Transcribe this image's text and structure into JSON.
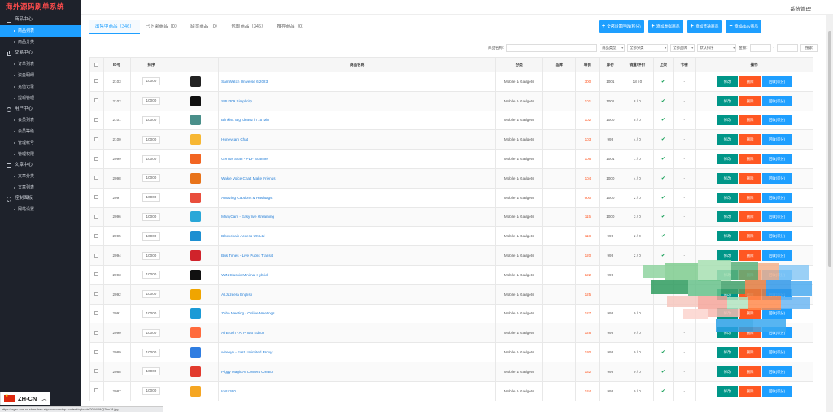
{
  "brand": "海外源码刷单系统",
  "header": {
    "sys_admin": "系统管理"
  },
  "sidebar": {
    "groups": [
      {
        "label": "商品中心",
        "icon": "house-icon",
        "items": [
          {
            "label": "商品列表",
            "active": true
          },
          {
            "label": "商品分类",
            "active": false
          }
        ]
      },
      {
        "label": "交易中心",
        "icon": "chart-icon",
        "items": [
          {
            "label": "订单列表",
            "active": false
          },
          {
            "label": "资金明细",
            "active": false
          },
          {
            "label": "充值记录",
            "active": false
          },
          {
            "label": "提现管理",
            "active": false
          }
        ]
      },
      {
        "label": "用户中心",
        "icon": "user-icon",
        "items": [
          {
            "label": "会员列表",
            "active": false
          },
          {
            "label": "会员等级",
            "active": false
          },
          {
            "label": "管理帐号",
            "active": false
          },
          {
            "label": "管理权限",
            "active": false
          }
        ]
      },
      {
        "label": "文章中心",
        "icon": "document-icon",
        "items": [
          {
            "label": "文章分类",
            "active": false
          },
          {
            "label": "文章列表",
            "active": false
          }
        ]
      },
      {
        "label": "控制面板",
        "icon": "gear-icon",
        "items": [
          {
            "label": "网站设置",
            "active": false
          }
        ]
      }
    ]
  },
  "language": {
    "code": "ZH-CN"
  },
  "status_url": "https://tsgzc-ecs-cn-shenzhen.aliyuncs.com/wp-content/uploads/2024/09/Q2ips18.jpg",
  "tabs": [
    {
      "label": "出售中商品（346）",
      "active": true
    },
    {
      "label": "已下架商品（0）",
      "active": false
    },
    {
      "label": "缺货商品（0）",
      "active": false
    },
    {
      "label": "包邮商品（346）",
      "active": false
    },
    {
      "label": "推荐商品（0）",
      "active": false
    }
  ],
  "actions": [
    "全部设置回收(积分)",
    "添加虚拟商品",
    "添加普通商品",
    "添加ebay商品"
  ],
  "filters": {
    "name_label": "商品名称:",
    "type_select": "商品类型",
    "category_select": "全部分类",
    "brand_select": "全部品牌",
    "sort_select": "默认排序",
    "price_label": "金额:",
    "range_sep": "-",
    "search_button": "搜索"
  },
  "table": {
    "columns": [
      "",
      "ID号",
      "排序",
      "",
      "商品名称",
      "分类",
      "品牌",
      "单价",
      "库存",
      "销量/评价",
      "上架",
      "卡密",
      "操作"
    ],
    "op_labels": {
      "edit": "修改",
      "delete": "删除",
      "recycle": "回收(积分)"
    },
    "rows": [
      {
        "id": "2103",
        "sort": "10000",
        "name": "SamWatch Universe 6 2023",
        "category": "Mobile & Gadgets",
        "price": "300",
        "stock": "1001",
        "sales": "18 / 0",
        "listed": "✔",
        "card": "-",
        "thumb": "#222222"
      },
      {
        "id": "2102",
        "sort": "10000",
        "name": "SPU309 Simplicity",
        "category": "Mobile & Gadgets",
        "price": "101",
        "stock": "1001",
        "sales": "8 / 0",
        "listed": "✔",
        "card": "-",
        "thumb": "#111111"
      },
      {
        "id": "2101",
        "sort": "10000",
        "name": "Blinkist: Big Ideas2 in 15 Min",
        "category": "Mobile & Gadgets",
        "price": "102",
        "stock": "1000",
        "sales": "5 / 0",
        "listed": "✔",
        "card": "-",
        "thumb": "#4a8f8a"
      },
      {
        "id": "2100",
        "sort": "10000",
        "name": "Honeycam Chat",
        "category": "Mobile & Gadgets",
        "price": "103",
        "stock": "999",
        "sales": "4 / 0",
        "listed": "✔",
        "card": "-",
        "thumb": "#f7b733"
      },
      {
        "id": "2099",
        "sort": "10000",
        "name": "Genius Scan - PDF Scanner",
        "category": "Mobile & Gadgets",
        "price": "106",
        "stock": "1001",
        "sales": "1 / 0",
        "listed": "✔",
        "card": "-",
        "thumb": "#f26522"
      },
      {
        "id": "2098",
        "sort": "10000",
        "name": "Wakie Voice Chat: Make Friends",
        "category": "Mobile & Gadgets",
        "price": "104",
        "stock": "1000",
        "sales": "4 / 0",
        "listed": "✔",
        "card": "-",
        "thumb": "#e8731a"
      },
      {
        "id": "2097",
        "sort": "10000",
        "name": "Amazing Captions & Hashtags",
        "category": "Mobile & Gadgets",
        "price": "900",
        "stock": "1000",
        "sales": "2 / 0",
        "listed": "✔",
        "card": "-",
        "thumb": "#e94e3c"
      },
      {
        "id": "2096",
        "sort": "10000",
        "name": "ManyCam - Easy live streaming",
        "category": "Mobile & Gadgets",
        "price": "115",
        "stock": "1000",
        "sales": "3 / 0",
        "listed": "✔",
        "card": "-",
        "thumb": "#2aa7d8"
      },
      {
        "id": "2095",
        "sort": "10000",
        "name": "Blockchain Access UK Ltd",
        "category": "Mobile & Gadgets",
        "price": "118",
        "stock": "999",
        "sales": "2 / 0",
        "listed": "✔",
        "card": "-",
        "thumb": "#1d8fd1"
      },
      {
        "id": "2094",
        "sort": "10000",
        "name": "Bus Times - Live Public Transit",
        "category": "Mobile & Gadgets",
        "price": "120",
        "stock": "999",
        "sales": "2 / 0",
        "listed": "✔",
        "card": "-",
        "thumb": "#d0232b"
      },
      {
        "id": "2093",
        "sort": "10000",
        "name": "WIN Classic Minimal Hybrid",
        "category": "Mobile & Gadgets",
        "price": "122",
        "stock": "999",
        "sales": "",
        "listed": "",
        "card": "",
        "thumb": "#111111"
      },
      {
        "id": "2092",
        "sort": "10000",
        "name": "Al Jazeera English",
        "category": "Mobile & Gadgets",
        "price": "125",
        "stock": "",
        "sales": "",
        "listed": "",
        "card": "",
        "thumb": "#f0a500"
      },
      {
        "id": "2091",
        "sort": "10000",
        "name": "Zoho Meeting - Online Meetings",
        "category": "Mobile & Gadgets",
        "price": "127",
        "stock": "999",
        "sales": "0 / 0",
        "listed": "",
        "card": "",
        "thumb": "#1b9ad6"
      },
      {
        "id": "2090",
        "sort": "10000",
        "name": "AirBrush - AI Photo Editor",
        "category": "Mobile & Gadgets",
        "price": "128",
        "stock": "999",
        "sales": "0 / 0",
        "listed": "",
        "card": "-",
        "thumb": "#ff6b3d"
      },
      {
        "id": "2089",
        "sort": "10000",
        "name": "wireoyn - Fast Unlimited Proxy",
        "category": "Mobile & Gadgets",
        "price": "130",
        "stock": "999",
        "sales": "0 / 0",
        "listed": "✔",
        "card": "-",
        "thumb": "#2f7de1"
      },
      {
        "id": "2088",
        "sort": "10000",
        "name": "Piggy Magic AI Content Creator",
        "category": "Mobile & Gadgets",
        "price": "132",
        "stock": "999",
        "sales": "0 / 0",
        "listed": "✔",
        "card": "-",
        "thumb": "#e23b2e"
      },
      {
        "id": "2087",
        "sort": "10000",
        "name": "Insta360",
        "category": "Mobile & Gadgets",
        "price": "134",
        "stock": "999",
        "sales": "0 / 0",
        "listed": "✔",
        "card": "-",
        "thumb": "#f5a623"
      }
    ]
  }
}
